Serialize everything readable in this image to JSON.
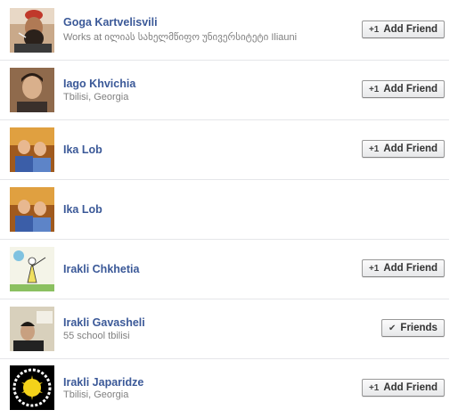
{
  "friends": [
    {
      "name": "Goga Kartvelisvili",
      "subtitle": "Works at ილიას სახელმწიფო უნივერსიტეტი Iliauni",
      "button": "Add Friend",
      "button_icon": "+1",
      "avatar": "man-smoking-beard"
    },
    {
      "name": "Iago Khvichia",
      "subtitle": "Tbilisi, Georgia",
      "button": "Add Friend",
      "button_icon": "+1",
      "avatar": "young-man-portrait"
    },
    {
      "name": "Ika Lob",
      "subtitle": "",
      "button": "Add Friend",
      "button_icon": "+1",
      "avatar": "two-boys-photo"
    },
    {
      "name": "Ika Lob",
      "subtitle": "",
      "button": "",
      "button_icon": "",
      "avatar": "two-boys-photo"
    },
    {
      "name": "Irakli Chkhetia",
      "subtitle": "",
      "button": "Add Friend",
      "button_icon": "+1",
      "avatar": "cartoon-drawing"
    },
    {
      "name": "Irakli Gavasheli",
      "subtitle": "55 school tbilisi",
      "button": "Friends",
      "button_icon": "✔",
      "avatar": "man-at-computer"
    },
    {
      "name": "Irakli Japaridze",
      "subtitle": "Tbilisi, Georgia",
      "button": "Add Friend",
      "button_icon": "+1",
      "avatar": "black-yellow-logo"
    }
  ],
  "colors": {
    "name_link": "#3b5998",
    "subtitle": "#808080",
    "divider": "#e5e6e9"
  }
}
